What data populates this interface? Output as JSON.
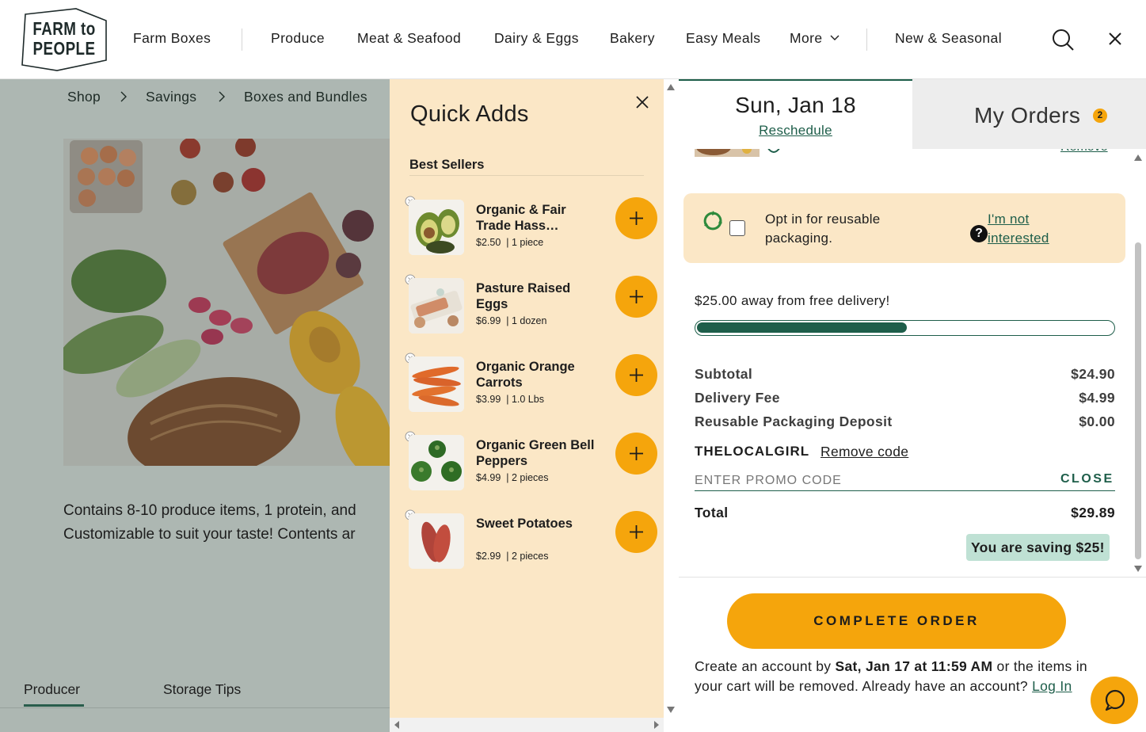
{
  "header": {
    "logo": "FARM to PEOPLE",
    "nav": [
      "Farm Boxes",
      "Produce",
      "Meat & Seafood",
      "Dairy & Eggs",
      "Bakery",
      "Easy Meals",
      "More",
      "New & Seasonal"
    ]
  },
  "page": {
    "breadcrumbs": [
      "Shop",
      "Savings",
      "Boxes and Bundles"
    ],
    "description_line1": "Contains 8-10 produce items, 1 protein, and",
    "description_line2": "Customizable to suit your taste! Contents ar",
    "tabs": [
      "Producer",
      "Storage Tips"
    ]
  },
  "quick_adds": {
    "title": "Quick Adds",
    "section": "Best Sellers",
    "items": [
      {
        "name": "Organic & Fair Trade Hass…",
        "price": "$2.50",
        "unit": "1 piece"
      },
      {
        "name": "Pasture Raised Eggs",
        "price": "$6.99",
        "unit": "1 dozen"
      },
      {
        "name": "Organic Orange Carrots",
        "price": "$3.99",
        "unit": "1.0 Lbs"
      },
      {
        "name": "Organic Green Bell Peppers",
        "price": "$4.99",
        "unit": "2 pieces"
      },
      {
        "name": "Sweet Potatoes",
        "price": "$2.99",
        "unit": "2 pieces"
      }
    ]
  },
  "cart": {
    "date_tab": "Sun, Jan 18",
    "reschedule": "Reschedule",
    "orders_tab": "My Orders",
    "orders_count": "2",
    "partial_link": "Remove",
    "reusable_text": "Opt in for reusable packaging.",
    "reusable_help": "?",
    "reusable_decline": "I'm not interested",
    "free_delivery_text": "$25.00 away from free delivery!",
    "free_delivery_progress": 0.5,
    "summary": [
      {
        "label": "Subtotal",
        "value": "$24.90"
      },
      {
        "label": "Delivery Fee",
        "value": "$4.99"
      },
      {
        "label": "Reusable Packaging Deposit",
        "value": "$0.00"
      }
    ],
    "promo_code": "THELOCALGIRL",
    "remove_code": "Remove code",
    "promo_placeholder": "ENTER PROMO CODE",
    "promo_close": "CLOSE",
    "total_label": "Total",
    "total_value": "$29.89",
    "saving": "You are saving $25!",
    "complete_button": "COMPLETE ORDER",
    "notice_pre": "Create an account by ",
    "notice_deadline": "Sat, Jan 17 at 11:59 AM",
    "notice_post": " or the items in your cart will be removed. Already have an account? ",
    "login": "Log In"
  },
  "colors": {
    "accent": "#f5a50c",
    "brand_green": "#1e5e4a",
    "panel_cream": "#fbe7c6"
  }
}
